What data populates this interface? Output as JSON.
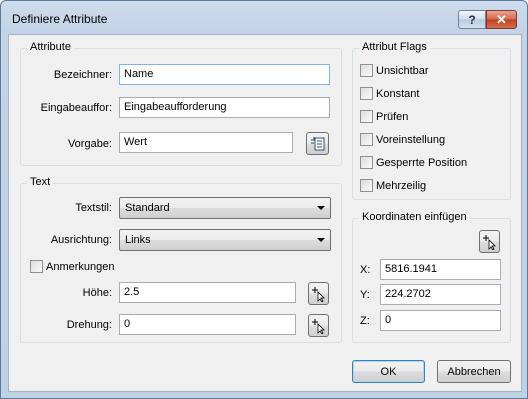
{
  "window": {
    "title": "Definiere Attribute",
    "help_label": "?",
    "close_label": "✕"
  },
  "attribute": {
    "group_label": "Attribute",
    "bezeichner_label": "Bezeichner:",
    "bezeichner_value": "Name",
    "eingabe_label": "Eingabeauffor:",
    "eingabe_value": "Eingabeaufforderung",
    "vorgabe_label": "Vorgabe:",
    "vorgabe_value": "Wert"
  },
  "text": {
    "group_label": "Text",
    "textstil_label": "Textstil:",
    "textstil_value": "Standard",
    "ausrichtung_label": "Ausrichtung:",
    "ausrichtung_value": "Links",
    "anmerkungen_label": "Anmerkungen",
    "hoehe_label": "Höhe:",
    "hoehe_value": "2.5",
    "drehung_label": "Drehung:",
    "drehung_value": "0"
  },
  "flags": {
    "group_label": "Attribut Flags",
    "items": [
      "Unsichtbar",
      "Konstant",
      "Prüfen",
      "Voreinstellung",
      "Gesperrte Position",
      "Mehrzeilig"
    ]
  },
  "coords": {
    "group_label": "Koordinaten einfügen",
    "x_label": "X:",
    "x_value": "5816.1941",
    "y_label": "Y:",
    "y_value": "224.2702",
    "z_label": "Z:",
    "z_value": "0"
  },
  "buttons": {
    "ok": "OK",
    "cancel": "Abbrechen"
  }
}
